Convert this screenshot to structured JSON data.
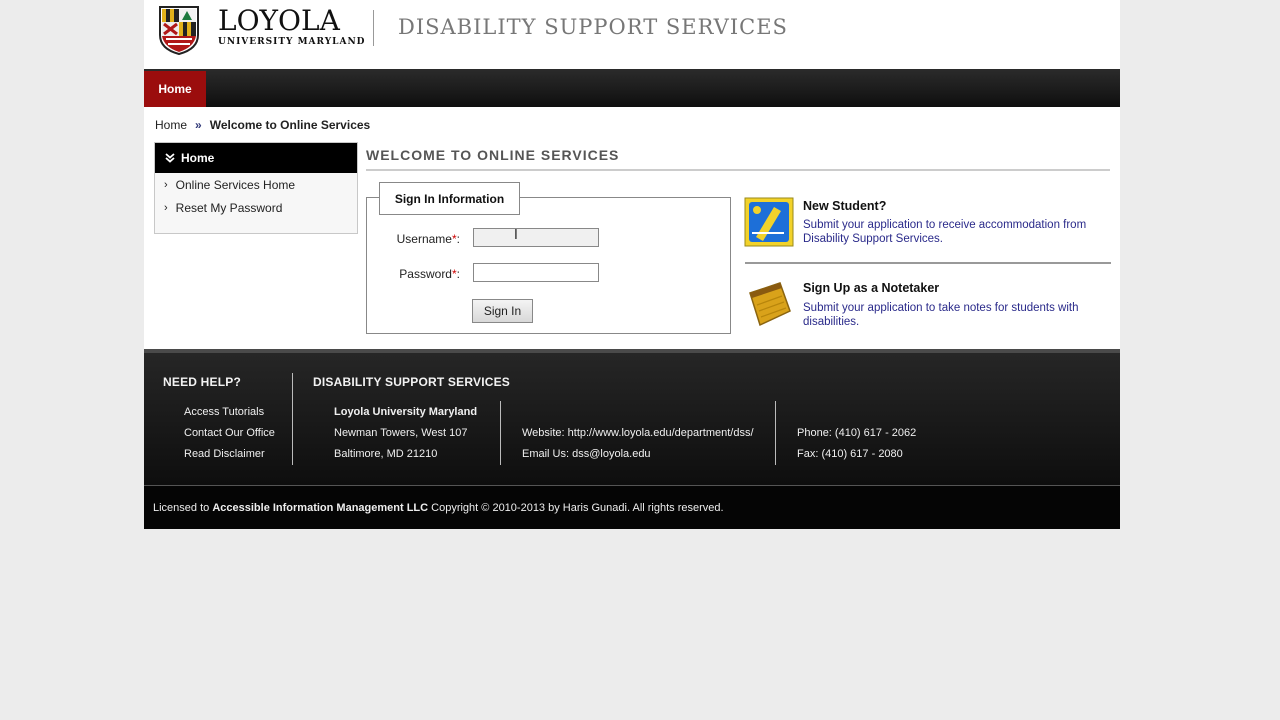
{
  "header": {
    "logo_name": "LOYOLA",
    "logo_sub": "UNIVERSITY MARYLAND",
    "dept_title": "DISABILITY SUPPORT SERVICES"
  },
  "nav": {
    "home": "Home"
  },
  "breadcrumb": {
    "home": "Home",
    "separator": "»",
    "current": "Welcome to Online Services"
  },
  "sidebar": {
    "title": "Home",
    "items": [
      {
        "label": "Online Services Home"
      },
      {
        "label": "Reset My Password"
      }
    ]
  },
  "main": {
    "title": "WELCOME TO ONLINE SERVICES",
    "signin": {
      "legend": "Sign In Information",
      "username_label": "Username",
      "password_label": "Password",
      "required_mark": "*",
      "colon": ":",
      "username_value": "",
      "password_value": "",
      "button": "Sign In"
    }
  },
  "promos": [
    {
      "title": "New Student?",
      "desc": "Submit your application to receive accommodation from Disability Support Services.",
      "icon": "new-student-icon"
    },
    {
      "title": "Sign Up as a Notetaker",
      "desc": "Submit your application to take notes for students with disabilities.",
      "icon": "notepad-icon"
    }
  ],
  "footer": {
    "help_title": "NEED HELP?",
    "help_links": [
      "Access Tutorials",
      "Contact Our Office",
      "Read Disclaimer"
    ],
    "dss_title": "DISABILITY SUPPORT SERVICES",
    "address": [
      "Loyola University Maryland",
      "Newman Towers, West 107",
      "Baltimore, MD 21210"
    ],
    "website": "Website: http://www.loyola.edu/department/dss/",
    "email": "Email Us: dss@loyola.edu",
    "phone": "Phone: (410) 617 - 2062",
    "fax": "Fax: (410) 617 - 2080"
  },
  "license": {
    "prefix": "Licensed to ",
    "company": "Accessible Information Management LLC",
    "suffix": " Copyright © 2010-2013 by Haris Gunadi. All rights reserved."
  },
  "colors": {
    "nav_active": "#9b0d0d",
    "link": "#2a2a8a",
    "required": "#cc0000"
  }
}
